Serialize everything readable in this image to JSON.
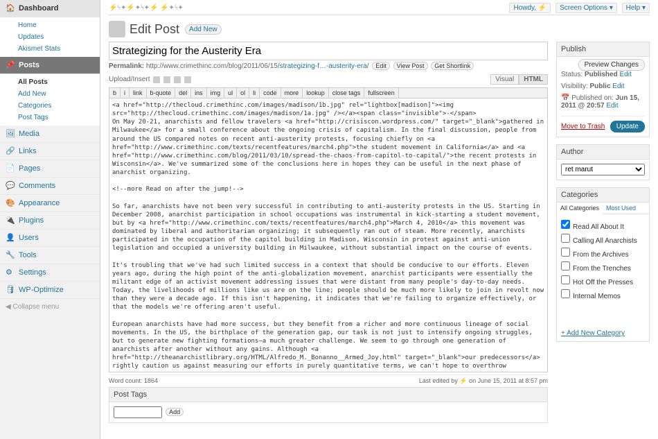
{
  "howdy": "Howdy, ⚡",
  "screen_opts": "Screen Options ▾",
  "help": "Help ▾",
  "site_glyph": "⚡ϟ✦⚡✦ϟ✦⚡ ⚡✦ϟ✦",
  "menu": {
    "dashboard": "Dashboard",
    "dash_sub": [
      "Home",
      "Updates",
      "Akismet Stats"
    ],
    "posts": "Posts",
    "posts_sub": [
      "All Posts",
      "Add New",
      "Categories",
      "Post Tags"
    ],
    "media": "Media",
    "links": "Links",
    "pages": "Pages",
    "comments": "Comments",
    "appearance": "Appearance",
    "plugins": "Plugins",
    "users": "Users",
    "tools": "Tools",
    "settings": "Settings",
    "wpopt": "WP-Optimize",
    "collapse": "Collapse menu"
  },
  "h2": "Edit Post",
  "addnew": "Add New",
  "title": "Strategizing for the Austerity Era",
  "perm_pre": "Permalink:",
  "perm_base": "http://www.crimethinc.com/blog/2011/06/15/",
  "perm_slug": "strategizing-f…-austerity-era/",
  "perm_edit": "Edit",
  "perm_view": "View Post",
  "perm_short": "Get Shortlink",
  "upload": "Upload/Insert",
  "visual": "Visual",
  "html": "HTML",
  "tb": [
    "b",
    "i",
    "link",
    "b-quote",
    "del",
    "ins",
    "img",
    "ul",
    "ol",
    "li",
    "code",
    "more",
    "lookup",
    "close tags",
    "fullscreen"
  ],
  "content": "<a href=\"http://thecloud.crimethinc.com/images/madison/1b.jpg\" rel=\"lightbox[madison]\"><img src=\"http://thecloud.crimethinc.com/images/madison/1a.jpg\" /></a><span class=\"invisible\">-</span>\nOn May 20-21, anarchists and fellow travelers <a href=\"http://crisiscon.wordpress.com/\" target=\"_blank\">gathered in Milwaukee</a> for a small conference about the ongoing crisis of capitalism. In the final discussion, people from around the US compared notes on recent anti-austerity protests, focusing chiefly on <a href=\"http://www.crimethinc.com/texts/recentfeatures/march4.php\">the student movement in California</a> and <a href=\"http://www.crimethinc.com/blog/2011/03/10/spread-the-chaos-from-capitol-to-capital/\">the recent protests in Wisconsin</a>. We've summarized some of the conclusions here in hopes they can be useful in the next phase of anarchist organizing.\n\n<!--more Read on after the jump!-->\n\nSo far, anarchists have not been very successful in contributing to anti-austerity protests in the US. Starting in December 2008, anarchist participation in school occupations was instrumental in kick-starting a student movement, but by <a href=\"http://www.crimethinc.com/texts/recentfeatures/march4.php\">March 4, 2010</a> this movement was dominated by liberal and authoritarian organizing; it subsequently ran out of steam. More recently, anarchists participated in the occupation of the capitol building in Madison, Wisconsin in protest against anti-union legislation and occupied a university building in Milwaukee, without substantial impact on the course of events.\n\nIt's troubling that we've had such limited success in a context that should be conducive to our efforts. Eleven years ago, during the high point of the anti-globalization movement, anarchist participants were essentially the militant edge of an activist movement addressing issues that were distant from many people's day-to-day needs. Today, the livelihoods of millions like us are on the line; people should be much more likely to join in revolt now than they were a decade ago. If this isn't happening, it indicates that we're failing to organize effectively, or that the models we're offering aren't useful.\n\nEuropean anarchists have had more success, but they benefit from a richer and more continuous lineage of social movements. In the US, the birthplace of the generation gap, our task is not just to intensify ongoing struggles, but to generate new fighting formations—a much greater challenge. We seem to go through one generation of anarchists after another without any gains. Although <a href=\"http://theanarchistlibrary.org/HTML/Alfredo_M._Bonanno__Armed_Joy.html\" target=\"_blank\">our predecessors</a> rightly caution us against measuring our efforts in purely quantitative terms, we can't hope to overthrow capitalism by our own isolated heroics, turning the world upside down one newspaper box at a time.\n\n<h3 align=\"right\">A small fire demands constant tending.<br />A bonfire can be let alone.<br />A conflagration spreads.</h3>\n\nWe have to figure out how to connect with everyone else who is suffering and angry. To that end, here are some observations and proposals derived from the conversations in Milwaukee.\n\n—The anti-austerity protests in Wisconsin are not the last of their kind; on the contrary, they herald the arrival of a new era. It is paramount that we learn from our early failures to develop a more effective strategy for engaging in these conflicts.\n\n—In Madison, anarchists largely focused on establishing infrastructure for the occupation. This is",
  "wc_label": "Word count:",
  "wc": "1864",
  "lastedit": "Last edited by ⚡ on June 15, 2011 at 8:57 pm",
  "publish": {
    "h": "Publish",
    "preview": "Preview Changes",
    "status_l": "Status:",
    "status": "Published",
    "edit": "Edit",
    "vis_l": "Visibility:",
    "vis": "Public",
    "pub_on": "Published on:",
    "pub_date": "Jun 15, 2011 @ 20:57",
    "trash": "Move to Trash",
    "update": "Update"
  },
  "author": {
    "h": "Author",
    "sel": "ret marut"
  },
  "cats": {
    "h": "Categories",
    "tab1": "All Categories",
    "tab2": "Most Used",
    "list": [
      "Read All About It",
      "Calling All Anarchists",
      "From the Archives",
      "From the Trenches",
      "Hot Off the Presses",
      "Internal Memos"
    ],
    "add": "+ Add New Category"
  },
  "tags": {
    "h": "Post Tags",
    "add": "Add"
  }
}
